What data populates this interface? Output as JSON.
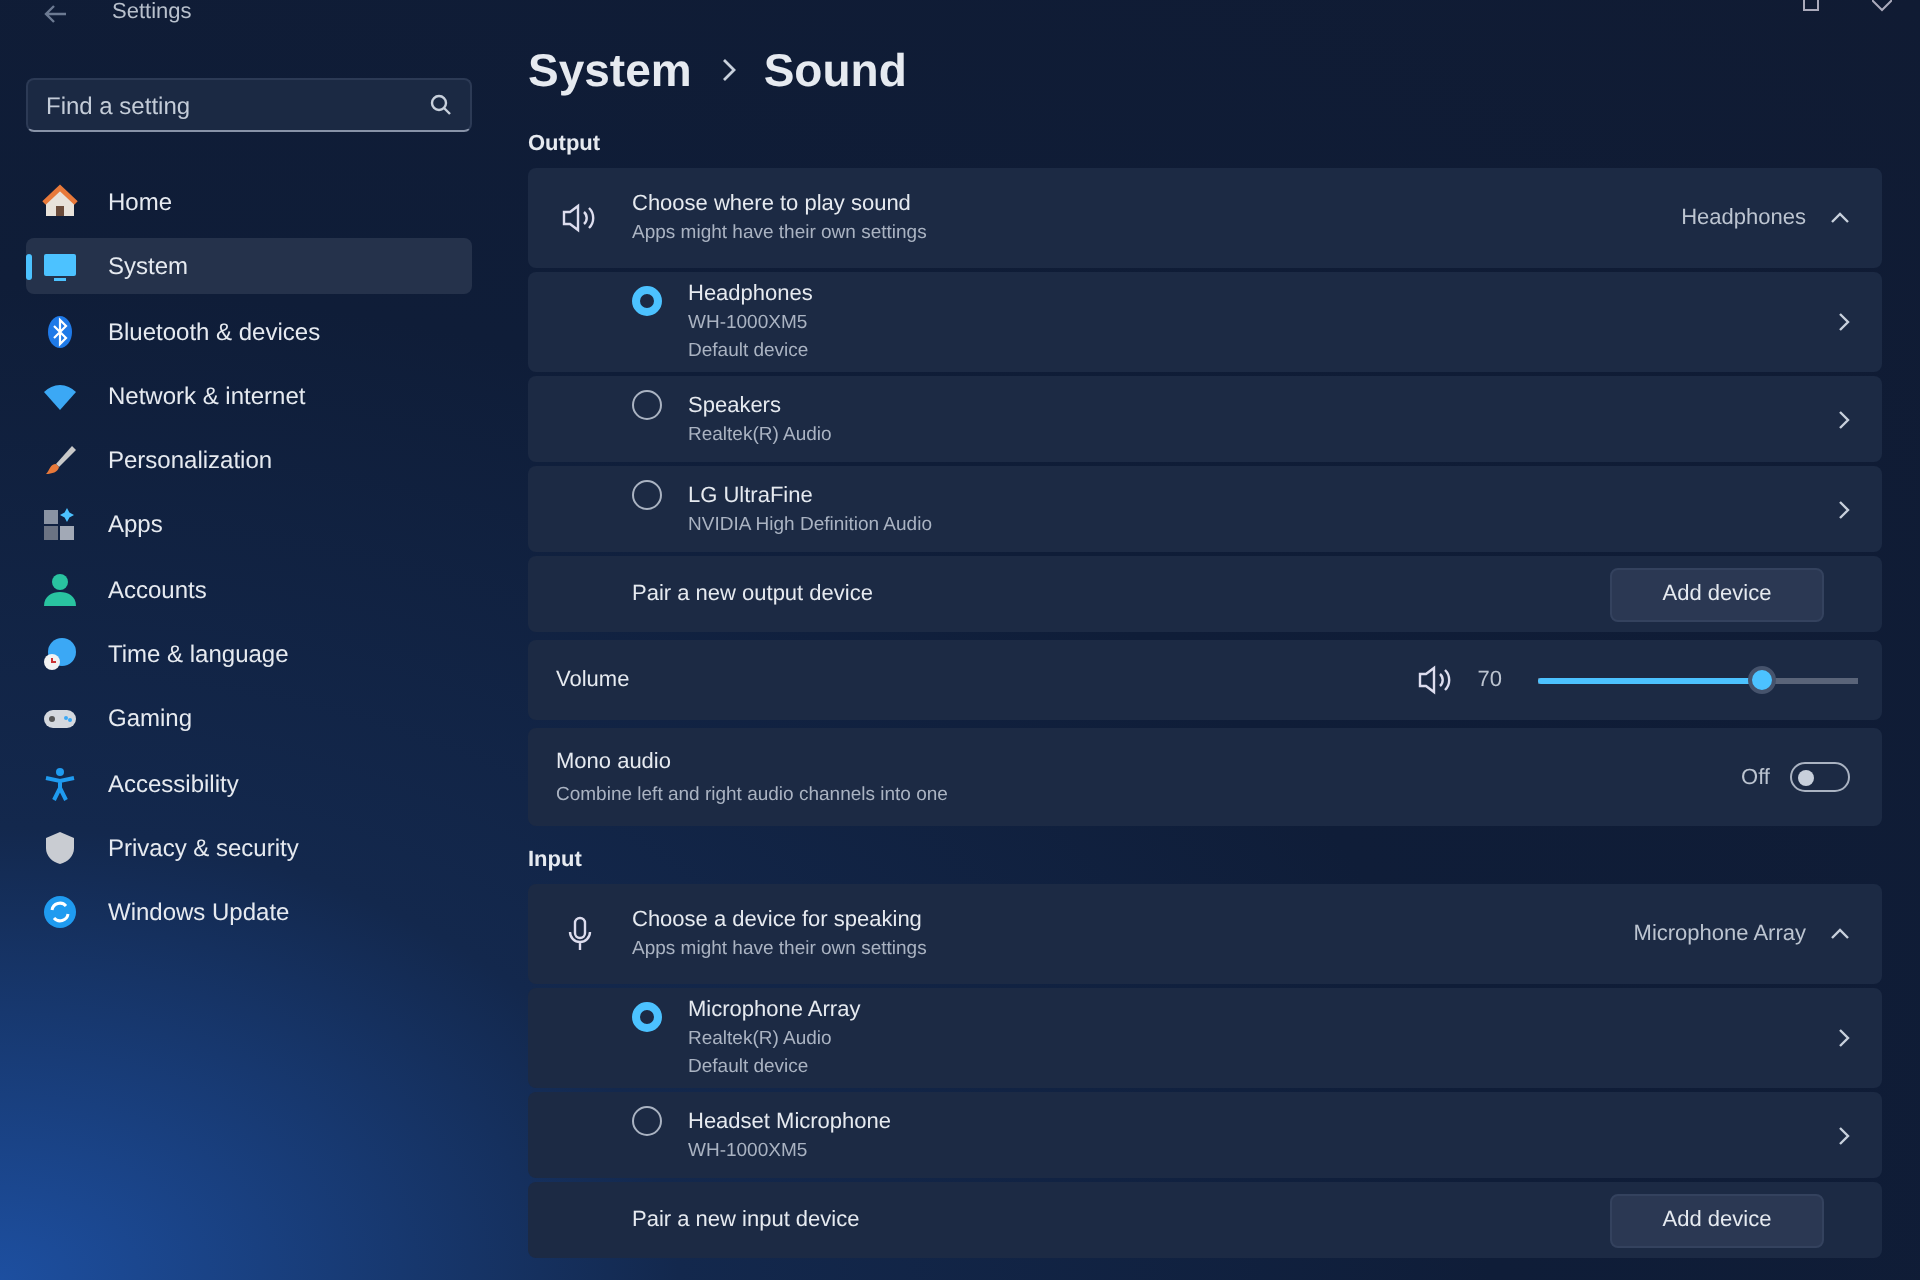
{
  "window": {
    "title": "Settings"
  },
  "search": {
    "placeholder": "Find a setting"
  },
  "sidebar": {
    "items": [
      {
        "label": "Home",
        "selected": false
      },
      {
        "label": "System",
        "selected": true
      },
      {
        "label": "Bluetooth & devices",
        "selected": false
      },
      {
        "label": "Network & internet",
        "selected": false
      },
      {
        "label": "Personalization",
        "selected": false
      },
      {
        "label": "Apps",
        "selected": false
      },
      {
        "label": "Accounts",
        "selected": false
      },
      {
        "label": "Time & language",
        "selected": false
      },
      {
        "label": "Gaming",
        "selected": false
      },
      {
        "label": "Accessibility",
        "selected": false
      },
      {
        "label": "Privacy & security",
        "selected": false
      },
      {
        "label": "Windows Update",
        "selected": false
      }
    ]
  },
  "breadcrumb": [
    "System",
    "Sound"
  ],
  "output": {
    "heading": "Output",
    "chooser": {
      "title": "Choose where to play sound",
      "subtitle": "Apps might have their own settings",
      "value": "Headphones",
      "expanded": true
    },
    "devices": [
      {
        "name": "Headphones",
        "details": [
          "WH-1000XM5",
          "Default device"
        ],
        "selected": true
      },
      {
        "name": "Speakers",
        "details": [
          "Realtek(R) Audio"
        ],
        "selected": false
      },
      {
        "name": "LG UltraFine",
        "details": [
          "NVIDIA High Definition Audio"
        ],
        "selected": false
      }
    ],
    "pair": {
      "label": "Pair a new output device",
      "button": "Add device"
    }
  },
  "volume": {
    "label": "Volume",
    "reading": "70",
    "level": 0.7
  },
  "mono_audio": {
    "title": "Mono audio",
    "subtitle": "Combine left and right audio channels into one",
    "state_label": "Off",
    "on": false
  },
  "input": {
    "heading": "Input",
    "chooser": {
      "title": "Choose a device for speaking",
      "subtitle": "Apps might have their own settings",
      "value": "Microphone Array",
      "expanded": true
    },
    "devices": [
      {
        "name": "Microphone Array",
        "details": [
          "Realtek(R) Audio",
          "Default device"
        ],
        "selected": true
      },
      {
        "name": "Headset Microphone",
        "details": [
          "WH-1000XM5"
        ],
        "selected": false
      }
    ],
    "pair": {
      "label": "Pair a new input device",
      "button": "Add device"
    }
  }
}
